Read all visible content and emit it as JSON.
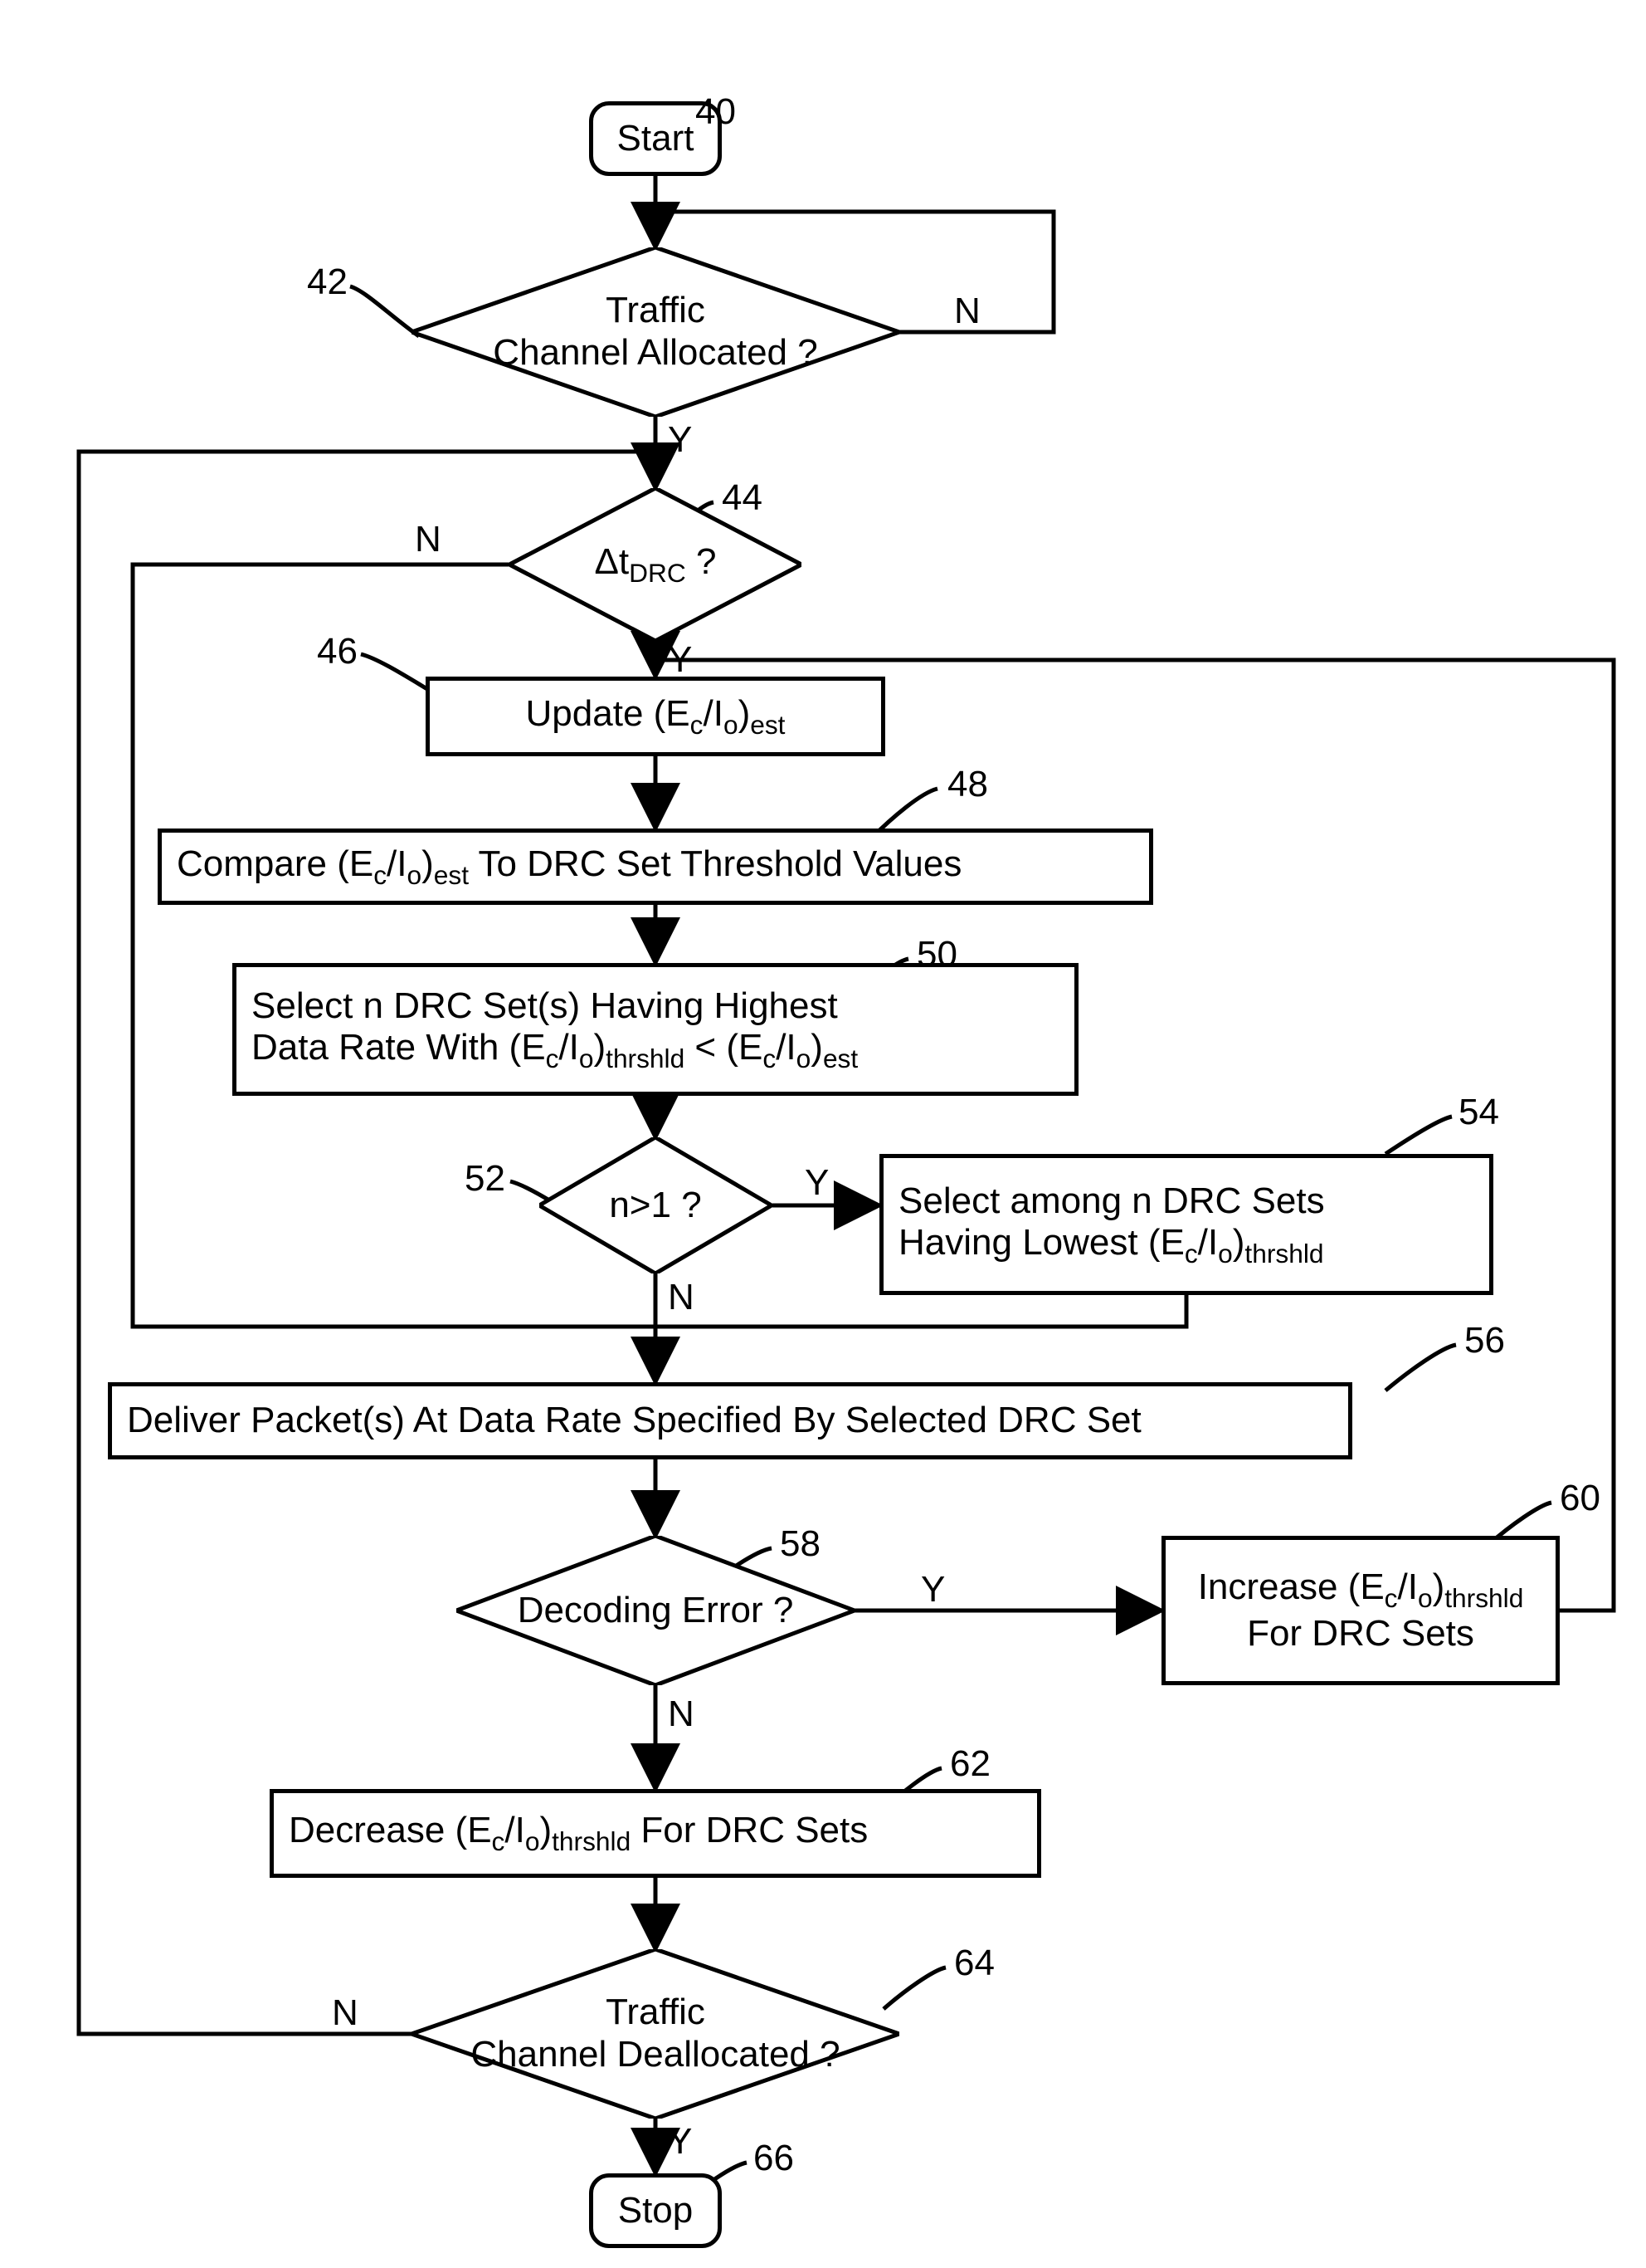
{
  "refs": {
    "r40": "40",
    "r42": "42",
    "r44": "44",
    "r46": "46",
    "r48": "48",
    "r50": "50",
    "r52": "52",
    "r54": "54",
    "r56": "56",
    "r58": "58",
    "r60": "60",
    "r62": "62",
    "r64": "64",
    "r66": "66"
  },
  "nodes": {
    "start": "Start",
    "stop": "Stop",
    "alloc_l1": "Traffic",
    "alloc_l2": "Channel Allocated ?",
    "dtdrc_pre": "Δt",
    "dtdrc_sub": "DRC",
    "dtdrc_post": " ?",
    "update_pre": "Update (E",
    "update_c": "c",
    "update_mid": "/I",
    "update_o": "o",
    "update_post": ")",
    "update_est": "est",
    "compare_pre": "Compare (E",
    "compare_c": "c",
    "compare_mid": "/I",
    "compare_o": "o",
    "compare_post": ")",
    "compare_est": "est",
    "compare_tail": "  To DRC Set Threshold Values",
    "select_l1": "Select n DRC Set(s) Having Highest",
    "select_l2_pre": "Data Rate With (E",
    "select_l2_c": "c",
    "select_l2_mid": "/I",
    "select_l2_o": "o",
    "select_l2_post": ")",
    "select_l2_thr": "thrshld",
    "select_l2_lt": " < (E",
    "select_l2_c2": "c",
    "select_l2_mid2": "/I",
    "select_l2_o2": "o",
    "select_l2_post2": ")",
    "select_l2_est": "est",
    "ngt1": "n>1 ?",
    "among_l1": "Select among n DRC Sets",
    "among_l2_pre": "Having Lowest (E",
    "among_l2_c": "c",
    "among_l2_mid": "/I",
    "among_l2_o": "o",
    "among_l2_post": ")",
    "among_l2_thr": "thrshld",
    "deliver": "Deliver Packet(s) At Data Rate Specified By Selected DRC Set",
    "decerr": "Decoding Error ?",
    "inc_l1_pre": "Increase (E",
    "inc_l1_c": "c",
    "inc_l1_mid": "/I",
    "inc_l1_o": "o",
    "inc_l1_post": ")",
    "inc_l1_thr": "thrshld",
    "inc_l2": "For DRC Sets",
    "dec_pre": "Decrease (E",
    "dec_c": "c",
    "dec_mid": "/I",
    "dec_o": "o",
    "dec_post": ")",
    "dec_thr": "thrshld",
    "dec_tail": " For DRC Sets",
    "dealloc_l1": "Traffic",
    "dealloc_l2": "Channel Deallocated ?"
  },
  "labels": {
    "Y": "Y",
    "N": "N"
  }
}
